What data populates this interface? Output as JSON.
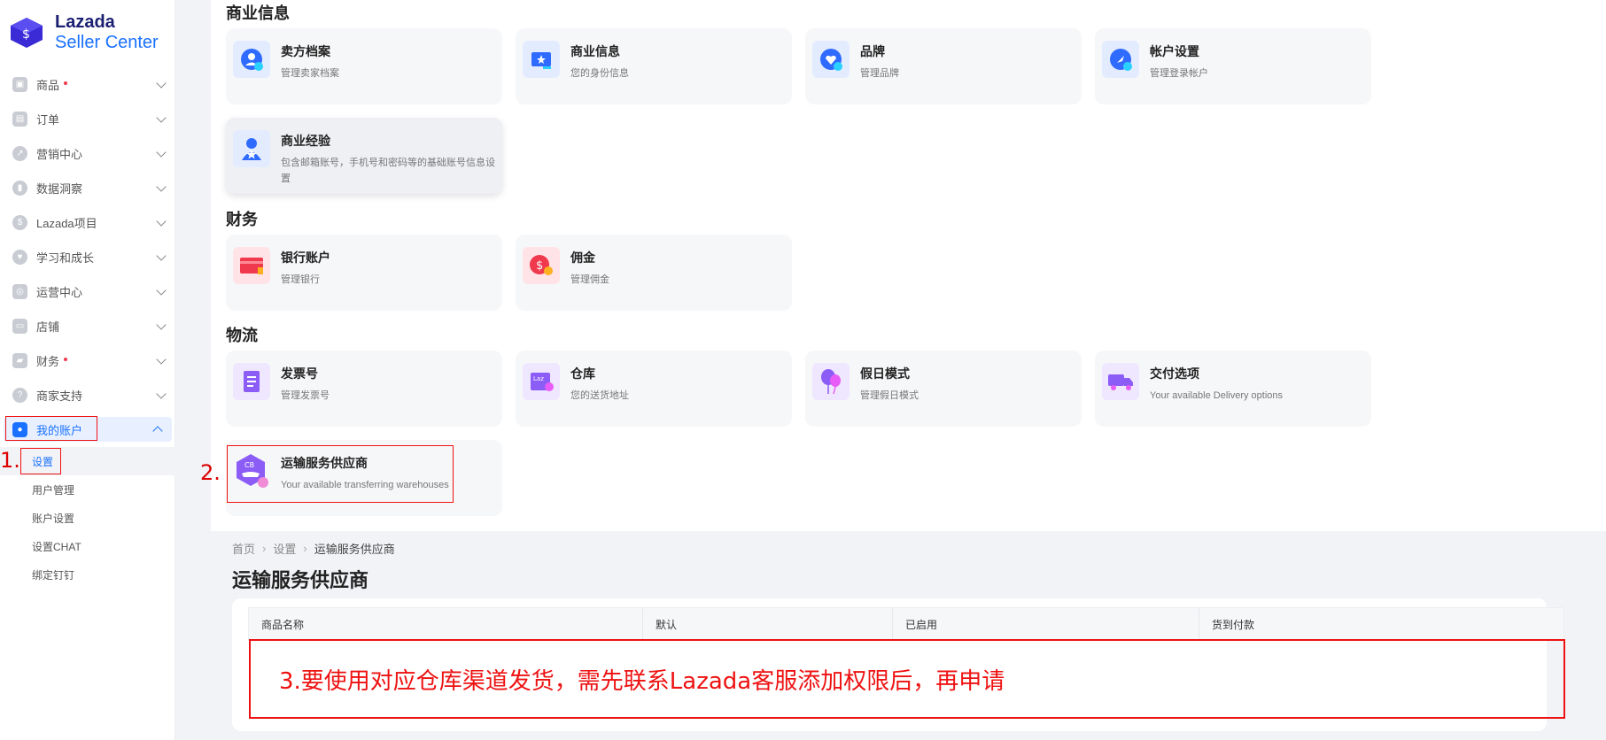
{
  "brand": {
    "name_line1": "Lazada",
    "name_line2": "Seller Center"
  },
  "sidebar": {
    "items": [
      {
        "label": "商品",
        "icon": "product-icon",
        "dot": true
      },
      {
        "label": "订单",
        "icon": "order-icon",
        "dot": false
      },
      {
        "label": "营销中心",
        "icon": "marketing-icon",
        "dot": false
      },
      {
        "label": "数据洞察",
        "icon": "data-insight-icon",
        "dot": false
      },
      {
        "label": "Lazada项目",
        "icon": "lazada-project-icon",
        "dot": false
      },
      {
        "label": "学习和成长",
        "icon": "learning-icon",
        "dot": false
      },
      {
        "label": "运营中心",
        "icon": "operations-icon",
        "dot": false
      },
      {
        "label": "店铺",
        "icon": "store-icon",
        "dot": false
      },
      {
        "label": "财务",
        "icon": "finance-icon",
        "dot": true
      },
      {
        "label": "商家支持",
        "icon": "support-icon",
        "dot": false
      }
    ],
    "active_item": {
      "label": "我的账户",
      "icon": "account-icon"
    },
    "submenu": [
      {
        "label": "设置"
      },
      {
        "label": "用户管理"
      },
      {
        "label": "账户设置"
      },
      {
        "label": "设置CHAT"
      },
      {
        "label": "绑定钉钉"
      }
    ]
  },
  "annotations": {
    "step1": "1.",
    "step2": "2.",
    "step3": "3.要使用对应仓库渠道发货，需先联系Lazada客服添加权限后，再申请"
  },
  "sections": {
    "business": {
      "title": "商业信息",
      "cards": [
        {
          "title": "卖方档案",
          "sub": "管理卖家档案",
          "icon": "profile-icon",
          "color": "#2f6bff"
        },
        {
          "title": "商业信息",
          "sub": "您的身份信息",
          "icon": "business-info-icon",
          "color": "#2f6bff"
        },
        {
          "title": "品牌",
          "sub": "管理品牌",
          "icon": "brand-icon",
          "color": "#2f6bff"
        },
        {
          "title": "帐户设置",
          "sub": "管理登录帐户",
          "icon": "account-settings-icon",
          "color": "#2f6bff"
        },
        {
          "title": "商业经验",
          "sub": "包含邮箱账号，手机号和密码等的基础账号信息设置",
          "icon": "business-experience-icon",
          "color": "#2f6bff"
        }
      ]
    },
    "finance": {
      "title": "财务",
      "cards": [
        {
          "title": "银行账户",
          "sub": "管理银行",
          "icon": "bank-account-icon",
          "color": "#f0394d"
        },
        {
          "title": "佣金",
          "sub": "管理佣金",
          "icon": "commission-icon",
          "color": "#f0394d"
        }
      ]
    },
    "logistics": {
      "title": "物流",
      "cards": [
        {
          "title": "发票号",
          "sub": "管理发票号",
          "icon": "invoice-icon",
          "color": "#8b5cf6"
        },
        {
          "title": "仓库",
          "sub": "您的送货地址",
          "icon": "warehouse-icon",
          "color": "#8b5cf6"
        },
        {
          "title": "假日模式",
          "sub": "管理假日模式",
          "icon": "holiday-mode-icon",
          "color": "#8b5cf6"
        },
        {
          "title": "交付选项",
          "sub": "Your available Delivery options",
          "icon": "delivery-options-icon",
          "color": "#8b5cf6"
        },
        {
          "title": "运输服务供应商",
          "sub": "Your available transferring warehouses",
          "icon": "shipping-provider-icon",
          "color": "#8b5cf6"
        }
      ]
    }
  },
  "bottom": {
    "breadcrumb": [
      "首页",
      "设置",
      "运输服务供应商"
    ],
    "page_title": "运输服务供应商",
    "table_headers": [
      "商品名称",
      "默认",
      "已启用",
      "货到付款"
    ]
  }
}
